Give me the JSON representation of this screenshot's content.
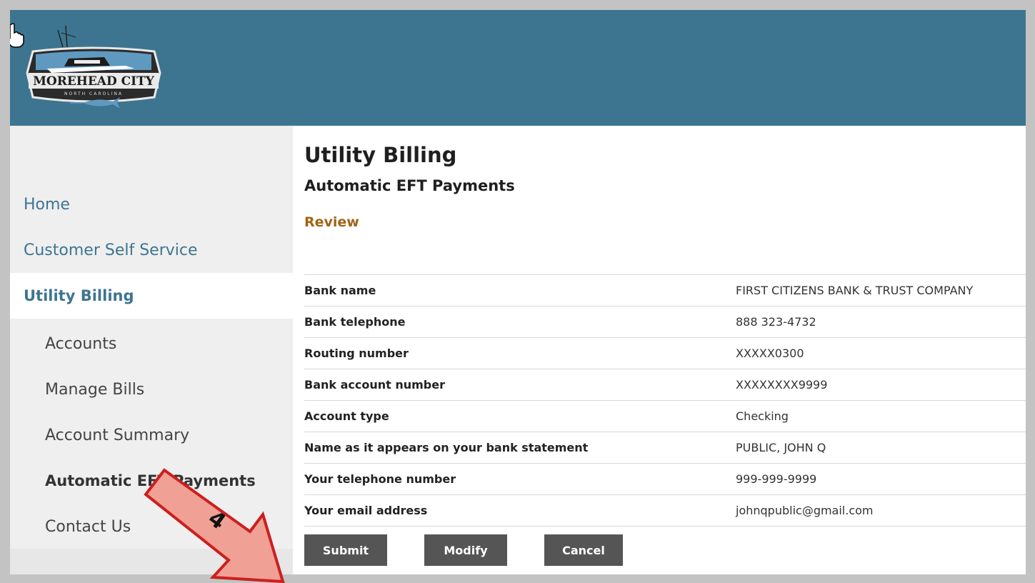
{
  "header": {
    "logo": {
      "title": "MOREHEAD CITY",
      "subtitle": "NORTH CAROLINA"
    }
  },
  "sidebar": {
    "items": [
      {
        "label": "Home"
      },
      {
        "label": "Customer Self Service"
      },
      {
        "label": "Utility Billing"
      },
      {
        "label": "Accounts"
      },
      {
        "label": "Manage Bills"
      },
      {
        "label": "Account Summary"
      },
      {
        "label": "Automatic EFT Payments"
      },
      {
        "label": "Contact Us"
      }
    ]
  },
  "main": {
    "title": "Utility Billing",
    "subtitle": "Automatic EFT Payments",
    "step": "Review",
    "rows": [
      {
        "label": "Bank name",
        "value": "FIRST CITIZENS BANK & TRUST COMPANY"
      },
      {
        "label": "Bank telephone",
        "value": "888 323-4732"
      },
      {
        "label": "Routing number",
        "value": "XXXXX0300"
      },
      {
        "label": "Bank account number",
        "value": "XXXXXXXX9999"
      },
      {
        "label": "Account type",
        "value": "Checking"
      },
      {
        "label": "Name as it appears on your bank statement",
        "value": "PUBLIC, JOHN Q"
      },
      {
        "label": "Your telephone number",
        "value": "999-999-9999"
      },
      {
        "label": "Your email address",
        "value": "johnqpublic@gmail.com"
      }
    ],
    "buttons": {
      "submit": "Submit",
      "modify": "Modify",
      "cancel": "Cancel"
    }
  },
  "annotation": {
    "step_number": "4"
  },
  "colors": {
    "header": "#3d7590",
    "nav_link": "#3d7590",
    "step_text": "#a06416",
    "button": "#555555",
    "arrow_fill": "#f0a095",
    "arrow_stroke": "#cc1f1f"
  }
}
